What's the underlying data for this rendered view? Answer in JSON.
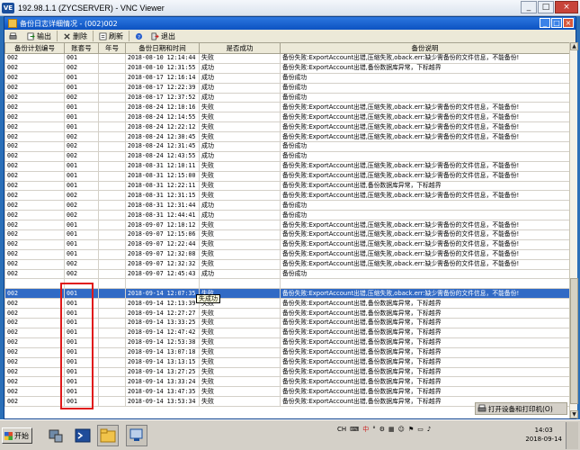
{
  "vnc": {
    "title": "192.98.1.1 (ZYCSERVER) - VNC Viewer",
    "logo": "VE"
  },
  "window": {
    "title": "备份日志详细情况 - (002)002",
    "controls": {
      "minimize": "_",
      "maximize": "□",
      "close": "×"
    }
  },
  "toolbar": {
    "print_label": "",
    "export_label": "输出",
    "delete_label": "删除",
    "refresh_label": "刷新",
    "exit_label": "退出"
  },
  "table": {
    "columns": [
      "备份计划编号",
      "账套号",
      "年号",
      "备份日期和时间",
      "是否成功",
      "备份说明"
    ],
    "selected_row": 24,
    "rows": [
      [
        "002",
        "001",
        "",
        "2018-08-10 12:14:44",
        "失败",
        "备份失败:ExportAccount出错,压缩失败,oback.err:缺少需备份的文件信息，不能备份!"
      ],
      [
        "002",
        "002",
        "",
        "2018-08-10 12:31:55",
        "成功",
        "备份失败:ExportAccount出错,备份数据库异常，下标越界"
      ],
      [
        "002",
        "001",
        "",
        "2018-08-17 12:16:14",
        "成功",
        "备份成功"
      ],
      [
        "002",
        "001",
        "",
        "2018-08-17 12:22:39",
        "成功",
        "备份成功"
      ],
      [
        "002",
        "002",
        "",
        "2018-08-17 12:37:52",
        "成功",
        "备份成功"
      ],
      [
        "002",
        "001",
        "",
        "2018-08-24 12:10:16",
        "失败",
        "备份失败:ExportAccount出错,压缩失败,oback.err:缺少需备份的文件信息，不能备份!"
      ],
      [
        "002",
        "001",
        "",
        "2018-08-24 12:14:55",
        "失败",
        "备份失败:ExportAccount出错,压缩失败,oback.err:缺少需备份的文件信息，不能备份!"
      ],
      [
        "002",
        "001",
        "",
        "2018-08-24 12:22:12",
        "失败",
        "备份失败:ExportAccount出错,压缩失败,oback.err:缺少需备份的文件信息，不能备份!"
      ],
      [
        "002",
        "002",
        "",
        "2018-08-24 12:30:45",
        "失败",
        "备份失败:ExportAccount出错,压缩失败,oback.err:缺少需备份的文件信息，不能备份!"
      ],
      [
        "002",
        "002",
        "",
        "2018-08-24 12:31:45",
        "成功",
        "备份成功"
      ],
      [
        "002",
        "002",
        "",
        "2018-08-24 12:43:55",
        "成功",
        "备份成功"
      ],
      [
        "002",
        "001",
        "",
        "2018-08-31 12:10:11",
        "失败",
        "备份失败:ExportAccount出错,压缩失败,oback.err:缺少需备份的文件信息，不能备份!"
      ],
      [
        "002",
        "001",
        "",
        "2018-08-31 12:15:00",
        "失败",
        "备份失败:ExportAccount出错,压缩失败,oback.err:缺少需备份的文件信息，不能备份!"
      ],
      [
        "002",
        "001",
        "",
        "2018-08-31 12:22:11",
        "失败",
        "备份失败:ExportAccount出错,备份数据库异常，下标越界"
      ],
      [
        "002",
        "002",
        "",
        "2018-08-31 12:31:15",
        "失败",
        "备份失败:ExportAccount出错,压缩失败,oback.err:缺少需备份的文件信息，不能备份!"
      ],
      [
        "002",
        "002",
        "",
        "2018-08-31 12:31:44",
        "成功",
        "备份成功"
      ],
      [
        "002",
        "002",
        "",
        "2018-08-31 12:44:41",
        "成功",
        "备份成功"
      ],
      [
        "002",
        "001",
        "",
        "2018-09-07 12:10:12",
        "失败",
        "备份失败:ExportAccount出错,压缩失败,oback.err:缺少需备份的文件信息，不能备份!"
      ],
      [
        "002",
        "001",
        "",
        "2018-09-07 12:15:06",
        "失败",
        "备份失败:ExportAccount出错,压缩失败,oback.err:缺少需备份的文件信息，不能备份!"
      ],
      [
        "002",
        "001",
        "",
        "2018-09-07 12:22:44",
        "失败",
        "备份失败:ExportAccount出错,压缩失败,oback.err:缺少需备份的文件信息，不能备份!"
      ],
      [
        "002",
        "001",
        "",
        "2018-09-07 12:32:08",
        "失败",
        "备份失败:ExportAccount出错,压缩失败,oback.err:缺少需备份的文件信息，不能备份!"
      ],
      [
        "002",
        "002",
        "",
        "2018-09-07 12:32:32",
        "失败",
        "备份失败:ExportAccount出错,压缩失败,oback.err:缺少需备份的文件信息，不能备份!"
      ],
      [
        "002",
        "002",
        "",
        "2018-09-07 12:45:43",
        "成功",
        "备份成功"
      ],
      [
        "",
        "",
        "",
        "",
        "",
        ""
      ],
      [
        "002",
        "001",
        "",
        "2018-09-14 12:07:35",
        "失败",
        "备份失败:ExportAccount出错,压缩失败,oback.err:缺少需备份的文件信息，不能备份!"
      ],
      [
        "002",
        "001",
        "",
        "2018-09-14 12:13:39",
        "失败",
        "备份失败:ExportAccount出错,备份数据库异常，下标越界"
      ],
      [
        "002",
        "001",
        "",
        "2018-09-14 12:27:27",
        "失败",
        "备份失败:ExportAccount出错,备份数据库异常，下标越界"
      ],
      [
        "002",
        "001",
        "",
        "2018-09-14 13:33:25",
        "失败",
        "备份失败:ExportAccount出错,备份数据库异常，下标越界"
      ],
      [
        "002",
        "001",
        "",
        "2018-09-14 12:47:42",
        "失败",
        "备份失败:ExportAccount出错,备份数据库异常，下标越界"
      ],
      [
        "002",
        "001",
        "",
        "2018-09-14 12:53:38",
        "失败",
        "备份失败:ExportAccount出错,备份数据库异常，下标越界"
      ],
      [
        "002",
        "001",
        "",
        "2018-09-14 13:07:18",
        "失败",
        "备份失败:ExportAccount出错,备份数据库异常，下标越界"
      ],
      [
        "002",
        "001",
        "",
        "2018-09-14 13:13:15",
        "失败",
        "备份失败:ExportAccount出错,备份数据库异常，下标越界"
      ],
      [
        "002",
        "001",
        "",
        "2018-09-14 13:27:25",
        "失败",
        "备份失败:ExportAccount出错,备份数据库异常，下标越界"
      ],
      [
        "002",
        "001",
        "",
        "2018-09-14 13:33:24",
        "失败",
        "备份失败:ExportAccount出错,备份数据库异常，下标越界"
      ],
      [
        "002",
        "001",
        "",
        "2018-09-14 13:47:35",
        "失败",
        "备份失败:ExportAccount出错,备份数据库异常，下标越界"
      ],
      [
        "002",
        "001",
        "",
        "2018-09-14 13:53:34",
        "失败",
        "备份失败:ExportAccount出错,备份数据库异常，下标越界"
      ]
    ]
  },
  "tooltip": {
    "text": "失成功"
  },
  "print_hint": {
    "label": "打开设备和打印机(O)"
  },
  "taskbar": {
    "start_label": "开始",
    "tray_lang": "CH",
    "tray_ime": "中",
    "clock_time": "14:03",
    "clock_date": "2018-09-14"
  },
  "colors": {
    "selection": "#316ac5",
    "highlight_box": "#e01818",
    "title_bar": "#0c52c1"
  }
}
